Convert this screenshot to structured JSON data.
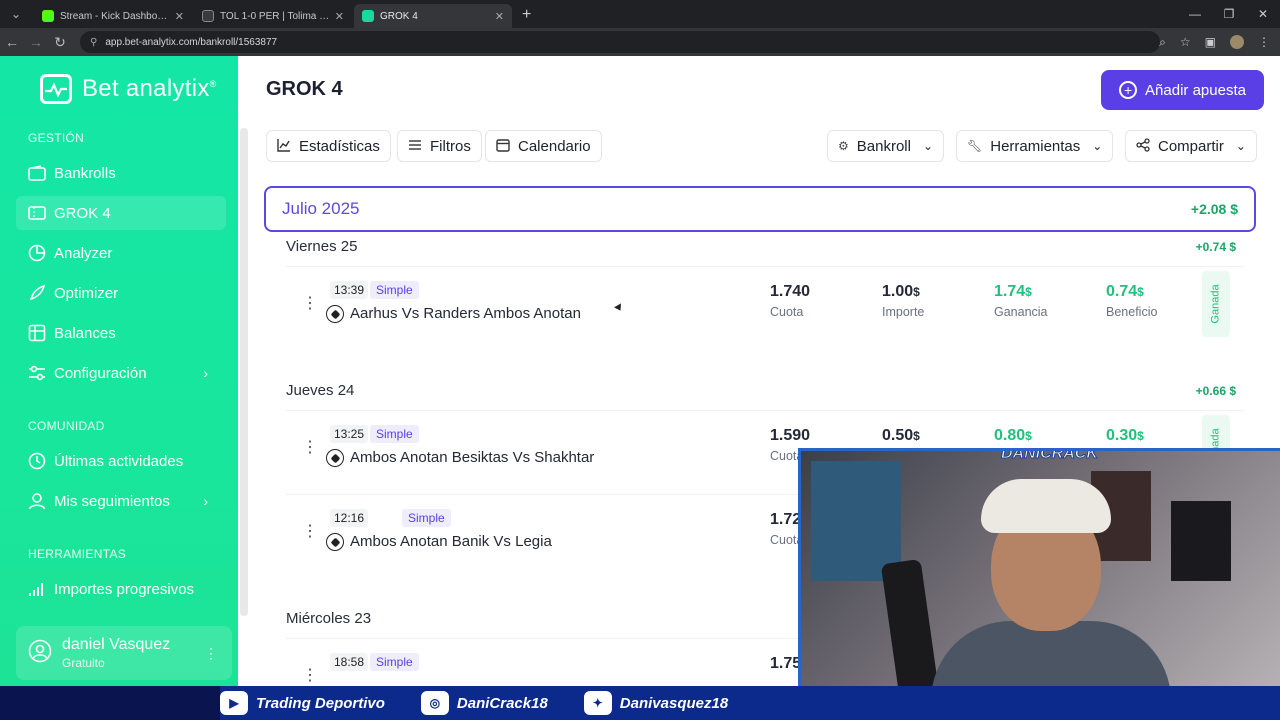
{
  "browser": {
    "tabs": [
      {
        "label": "Stream - Kick Dashboard",
        "color": "#53fc18"
      },
      {
        "label": "TOL 1-0 PER | Tolima - Pereira |",
        "color": "#3a3a3a"
      },
      {
        "label": "GROK 4",
        "color": "#19d8a0"
      }
    ],
    "url": "app.bet-analytix.com/bankroll/1563877"
  },
  "sidebar": {
    "logo": "Bet analytix",
    "logo_mark": "®",
    "sections": {
      "gestion": "GESTIÓN",
      "comunidad": "COMUNIDAD",
      "herramientas": "HERRAMIENTAS"
    },
    "items": [
      {
        "label": "Bankrolls",
        "icon": "wallet-icon"
      },
      {
        "label": "GROK 4",
        "icon": "ticket-icon"
      },
      {
        "label": "Analyzer",
        "icon": "pie-chart-icon"
      },
      {
        "label": "Optimizer",
        "icon": "rocket-icon"
      },
      {
        "label": "Balances",
        "icon": "table-icon"
      },
      {
        "label": "Configuración",
        "icon": "sliders-icon"
      },
      {
        "label": "Últimas actividades",
        "icon": "clock-icon"
      },
      {
        "label": "Mis seguimientos",
        "icon": "user-icon"
      },
      {
        "label": "Importes progresivos",
        "icon": "bars-icon"
      }
    ],
    "user": {
      "name": "daniel Vasquez",
      "plan": "Gratuito"
    }
  },
  "main": {
    "title": "GROK 4",
    "add_button": "Añadir apuesta",
    "toolbar": {
      "estadisticas": "Estadísticas",
      "filtros": "Filtros",
      "calendario": "Calendario",
      "bankroll": "Bankroll",
      "herramientas": "Herramientas",
      "compartir": "Compartir"
    },
    "month": {
      "name": "Julio 2025",
      "total": "+2.08 $"
    },
    "days": [
      {
        "label": "Viernes 25",
        "total": "+0.74 $"
      },
      {
        "label": "Jueves 24",
        "total": "+0.66 $"
      },
      {
        "label": "Miércoles 23"
      }
    ],
    "bets": [
      {
        "time": "13:39",
        "type": "Simple",
        "event": "Aarhus Vs Randers Ambos Anotan",
        "cuota": "1.740",
        "importe": "1.00",
        "ganancia": "1.74",
        "beneficio": "0.74",
        "status": "Ganada"
      },
      {
        "time": "13:25",
        "type": "Simple",
        "event": "Ambos Anotan Besiktas Vs Shakhtar",
        "cuota": "1.590",
        "importe": "0.50",
        "ganancia": "0.80",
        "beneficio": "0.30",
        "status": "Ganada"
      },
      {
        "time": "12:16",
        "type": "Simple",
        "event": "Ambos Anotan Banik Vs Legia",
        "cuota": "1.72"
      },
      {
        "time": "18:58",
        "type": "Simple",
        "cuota": "1.75"
      }
    ],
    "labels": {
      "cuota": "Cuota",
      "importe": "Importe",
      "ganancia": "Ganancia",
      "beneficio": "Beneficio",
      "currency": "$"
    }
  },
  "overlay": {
    "brand": "DANICRACK",
    "socials": [
      {
        "icon": "youtube-icon",
        "label": "Trading Deportivo"
      },
      {
        "icon": "instagram-icon",
        "label": "DaniCrack18"
      },
      {
        "icon": "twitter-icon",
        "label": "Danivasquez18"
      }
    ]
  }
}
